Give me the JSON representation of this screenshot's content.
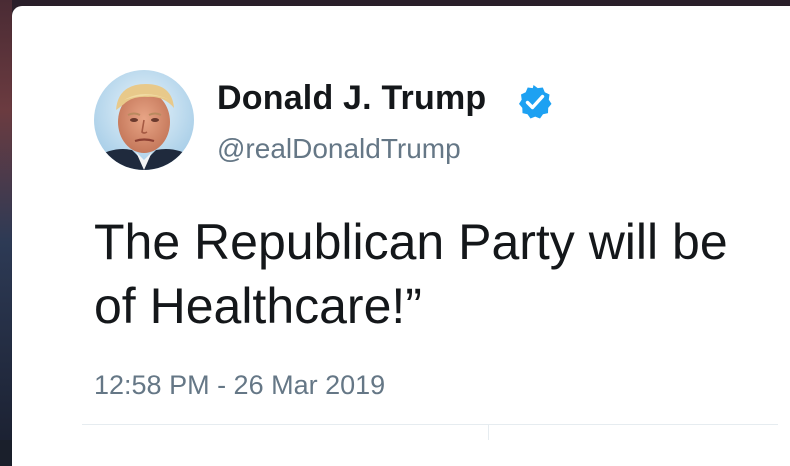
{
  "tweet": {
    "author": {
      "display_name": "Donald J. Trump",
      "handle": "@realDonaldTrump",
      "verified": true,
      "avatar_icon": "profile-photo"
    },
    "text_lines": [
      "The Republican Party will be",
      "of Healthcare!”"
    ],
    "timestamp": "12:58 PM - 26 Mar 2019"
  },
  "colors": {
    "card_background": "#ffffff",
    "primary_text": "#14171a",
    "secondary_text": "#657786",
    "verified_badge": "#1da1f2",
    "divider": "#e6ecf0"
  }
}
